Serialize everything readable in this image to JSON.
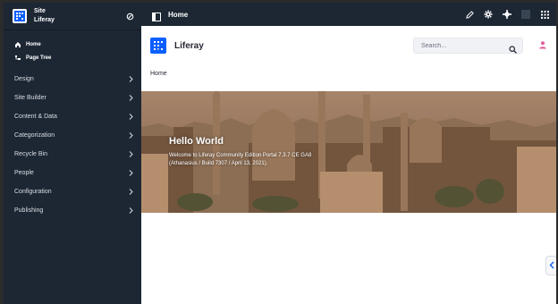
{
  "sidebar": {
    "site_label": "Site",
    "site_name": "Liferay",
    "sub_items": [
      {
        "label": "Home",
        "icon": "home-icon"
      },
      {
        "label": "Page Tree",
        "icon": "page-tree-icon"
      }
    ],
    "menu": [
      {
        "label": "Design"
      },
      {
        "label": "Site Builder"
      },
      {
        "label": "Content & Data"
      },
      {
        "label": "Categorization"
      },
      {
        "label": "Recycle Bin"
      },
      {
        "label": "People"
      },
      {
        "label": "Configuration"
      },
      {
        "label": "Publishing"
      }
    ]
  },
  "topbar": {
    "title": "Home",
    "icons": [
      "edit-icon",
      "gear-icon",
      "simulation-icon",
      "apps-grid-icon"
    ]
  },
  "header": {
    "brand_name": "Liferay",
    "search_placeholder": "Search..."
  },
  "breadcrumb": "Home",
  "banner": {
    "title": "Hello World",
    "line1": "Welcome to Liferay Community Edition Portal 7.3.7 CE GA8",
    "line2": "(Athanasius / Build 7307 / April 13, 2021)."
  },
  "colors": {
    "sidebar_bg": "#1d2734",
    "brand_blue": "#0b5fff",
    "user_pink": "#e05d9c"
  }
}
